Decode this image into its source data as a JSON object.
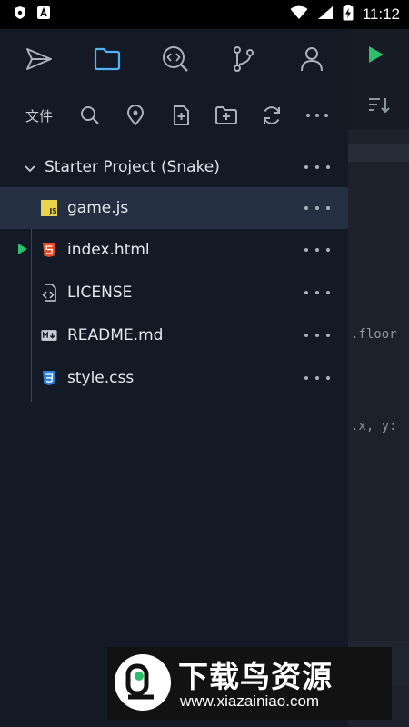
{
  "status_bar": {
    "time": "11:12"
  },
  "nav": {
    "items": [
      "send-icon",
      "folder-icon",
      "code-search-icon",
      "git-branch-icon",
      "account-icon"
    ],
    "active": "folder-icon",
    "accent_color": "#4fb3f6"
  },
  "explorer": {
    "label": "文件",
    "project_name": "Starter Project (Snake)",
    "files": [
      {
        "name": "game.js",
        "icon": "js-file-icon",
        "selected": true
      },
      {
        "name": "index.html",
        "icon": "html-file-icon",
        "running": true
      },
      {
        "name": "LICENSE",
        "icon": "code-file-icon"
      },
      {
        "name": "README.md",
        "icon": "markdown-file-icon"
      },
      {
        "name": "style.css",
        "icon": "css-file-icon"
      }
    ]
  },
  "editor": {
    "code_fragments": [
      ".floor",
      ".x, y:"
    ]
  },
  "watermark": {
    "title": "下载鸟资源",
    "url": "www.xiazainiao.com"
  }
}
